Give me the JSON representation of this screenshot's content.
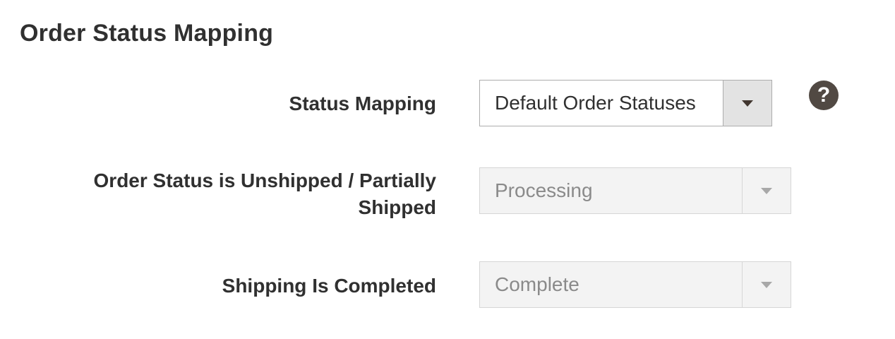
{
  "section": {
    "title": "Order Status Mapping"
  },
  "fields": [
    {
      "label": "Status Mapping",
      "value": "Default Order Statuses",
      "disabled": false
    },
    {
      "label": "Order Status is Unshipped / Partially Shipped",
      "value": "Processing",
      "disabled": true
    },
    {
      "label": "Shipping Is Completed",
      "value": "Complete",
      "disabled": true
    }
  ],
  "help": {
    "icon": "question-circle-icon",
    "glyph": "?"
  },
  "colors": {
    "text": "#303030",
    "border": "#adadad",
    "arrow_bg": "#e3e3e3",
    "disabled_bg": "#f3f3f3",
    "disabled_text": "#8a8a8a",
    "help_icon_bg": "#514943"
  }
}
